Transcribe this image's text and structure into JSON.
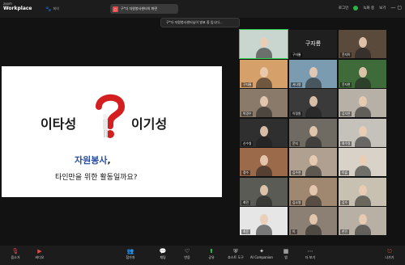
{
  "topbar": {
    "logo_line1": "zoom",
    "logo_line2": "Workplace",
    "paw_label": "회의",
    "share_tab_label": "구*다 자원봉사센터의 화면",
    "sign_in": "로그인",
    "status_label": "녹화 중",
    "window_label": "보기"
  },
  "toast": {
    "text": "구*다 자원봉사센터님이 발표 중 입니다..."
  },
  "slide": {
    "word_left": "이타성",
    "word_right": "이기성",
    "subtitle": "자원봉사",
    "subtitle_punct": ",",
    "question": "타인만을 위한 활동일까요?"
  },
  "gallery": {
    "tiles": [
      {
        "name": "",
        "type": "photo"
      },
      {
        "name": "구자룡",
        "type": "dark",
        "label": "구자룡"
      },
      {
        "name": "윤지아",
        "type": "photo"
      },
      {
        "name": "구자룡",
        "type": "photo"
      },
      {
        "name": "서나영",
        "type": "photo"
      },
      {
        "name": "윤지현",
        "type": "photo"
      },
      {
        "name": "박경수",
        "type": "photo"
      },
      {
        "name": "이정원",
        "type": "photo"
      },
      {
        "name": "김지연",
        "type": "photo"
      },
      {
        "name": "신수영",
        "type": "photo"
      },
      {
        "name": "문지",
        "type": "photo"
      },
      {
        "name": "최수영",
        "type": "photo"
      },
      {
        "name": "정수",
        "type": "photo"
      },
      {
        "name": "김수연",
        "type": "photo"
      },
      {
        "name": "이슬",
        "type": "photo"
      },
      {
        "name": "최민",
        "type": "photo"
      },
      {
        "name": "김소영",
        "type": "photo"
      },
      {
        "name": "김수",
        "type": "photo"
      },
      {
        "name": "최윤",
        "type": "photo"
      },
      {
        "name": "이",
        "type": "photo"
      },
      {
        "name": "한민",
        "type": "photo"
      }
    ]
  },
  "toolbar": {
    "items": [
      {
        "label": "음소거",
        "icon": "mic-icon"
      },
      {
        "label": "비디오",
        "icon": "video-icon"
      },
      {
        "label": "참가자",
        "icon": "participants-icon"
      },
      {
        "label": "채팅",
        "icon": "chat-icon"
      },
      {
        "label": "반응",
        "icon": "heart-icon"
      },
      {
        "label": "공유",
        "icon": "share-icon"
      },
      {
        "label": "호스트 도구",
        "icon": "shield-icon"
      },
      {
        "label": "AI Companion",
        "icon": "ai-icon"
      },
      {
        "label": "앱",
        "icon": "apps-icon"
      },
      {
        "label": "더 보기",
        "icon": "more-icon"
      },
      {
        "label": "나가기",
        "icon": "leave-icon"
      }
    ]
  },
  "colors": {
    "accent_green": "#2bd34d",
    "accent_red": "#e24b4b",
    "slide_blue": "#2a4fa3"
  }
}
